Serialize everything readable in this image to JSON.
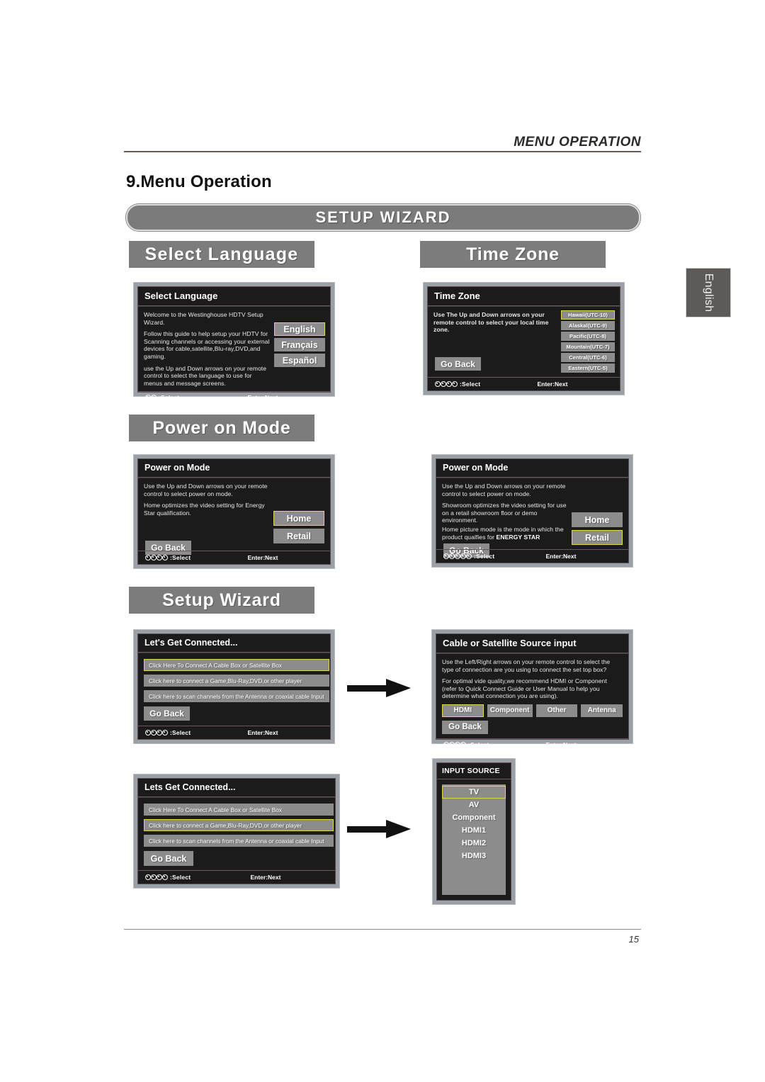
{
  "header": {
    "running_head": "MENU OPERATION",
    "section_title": "9.Menu Operation",
    "wizard_banner": "SETUP  WIZARD",
    "language_tab": "English"
  },
  "banners": {
    "select_language": "Select  Language",
    "time_zone": "Time Zone",
    "power_on_mode": "Power on Mode",
    "setup_wizard": "Setup Wizard"
  },
  "footer_hints": {
    "select": ":Select",
    "select_nospace": ":Select",
    "enter_next": "Enter:Next"
  },
  "panels": {
    "select_language": {
      "title": "Select Language",
      "body": [
        "Welcome to the Westinghouse HDTV Setup Wizard.",
        "Follow this guide to help setup your HDTV for Scanning channels or accessing your external devices for cable,satellite,Blu-ray,DVD,and gaming.",
        "use the Up and Down arrows on your remote control to select the language to use for menus and message screens."
      ],
      "options": [
        "English",
        "Français",
        "Español"
      ],
      "selected": "English",
      "dots": 2
    },
    "time_zone": {
      "title": "Time Zone",
      "body": [
        "Use The Up and Down arrows on your remote control to select your local time zone."
      ],
      "options": [
        "Hawaii(UTC-10)",
        "Alaskal(UTC-9)",
        "Pacific(UTC-8)",
        "Mountain(UTC-7)",
        "Central(UTC-6)",
        "Eastern(UTC-5)"
      ],
      "selected": "Hawaii(UTC-10)",
      "go_back": "Go Back",
      "dots": 4
    },
    "power_on_mode_home": {
      "title": "Power on Mode",
      "body": [
        "Use the Up and Down arrows on your remote control to select power on mode.",
        "Home optimizes the video setting for Energy Star qualification."
      ],
      "options": [
        "Home",
        "Retail"
      ],
      "selected": "Home",
      "go_back": "Go Back",
      "dots": 4
    },
    "power_on_mode_retail": {
      "title": "Power on Mode",
      "body": [
        "Use the Up and Down arrows on your remote control to select power on mode.",
        "Showroom optimizes the video setting for use on a retail showroom floor or demo environment.",
        "Home picture mode is the mode in which the product qualfies for "
      ],
      "energy_star": "ENERGY STAR",
      "options": [
        "Home",
        "Retail"
      ],
      "selected": "Retail",
      "go_back": "Go Back",
      "dots": 5
    },
    "lets_get_connected_cable": {
      "title": "Let's Get Connected...",
      "options": [
        "Click Here To Connect A Cable Box or  Satellite Box",
        "Click here to connect a Game,Blu-Ray,DVD,or other player",
        "Click here to scan channels from the Antenna or coaxial cable Input"
      ],
      "selected_index": 0,
      "go_back": "Go Back",
      "dots": 4
    },
    "cable_or_satellite_source": {
      "title": "Cable or Satellite Source input",
      "body": [
        "Use the Left/Right arrows on your remote control to select the type of connection are you using to connect the set top box?",
        "For optimal vide quality,we recommend HDMI or Component (refer to Quick Connect Guide or User Manual to help you determine what connection you are using)."
      ],
      "options": [
        "HDMI",
        "Component",
        "Other",
        "Antenna"
      ],
      "selected": "HDMI",
      "go_back": "Go Back",
      "dots": 4
    },
    "lets_get_connected_game": {
      "title": "Lets Get Connected...",
      "options": [
        "Click Here To Connect A Cable Box or Satellite Box",
        "Click here to connect a Game,Blu-Ray,DVD,or other player",
        "Click here to scan channels from the Antenna or coaxial cable Input"
      ],
      "selected_index": 1,
      "go_back": "Go Back",
      "dots": 4
    },
    "input_source": {
      "title": "INPUT SOURCE",
      "options": [
        "TV",
        "AV",
        "Component",
        "HDMI1",
        "HDMI2",
        "HDMI3"
      ],
      "selected": "TV"
    }
  },
  "page_number": "15",
  "colors": {
    "banner_gray": "#7c7c7c",
    "osd_bezel": "#9aa0a6",
    "osd_background": "#1b1b1b",
    "button_gray": "#8c8c8c",
    "highlight_border": "#e8d44a",
    "rule_brown": "#6b5a52"
  }
}
